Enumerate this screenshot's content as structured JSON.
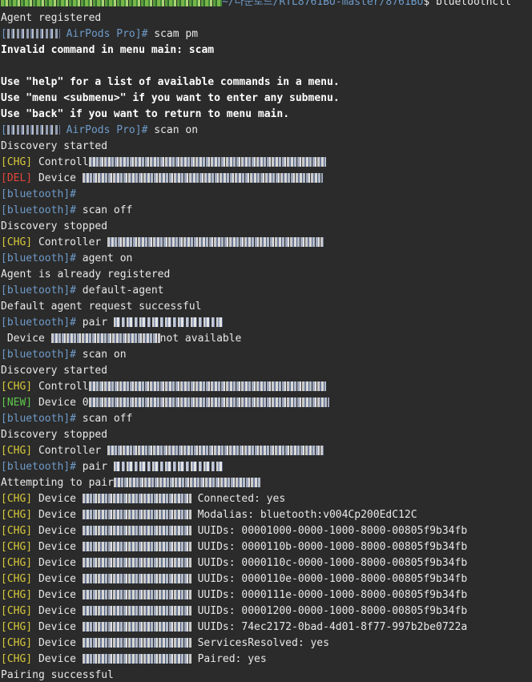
{
  "window": {
    "cwd_path": "~/다운로드/RTL8761BU-master/8761BU",
    "command": "$ bluetoothctl"
  },
  "labels": {
    "prompt_airpods": "AirPods Pro]#",
    "prompt_bluetooth": "[bluetooth]#",
    "prompt_open": "[",
    "chg": "[CHG]",
    "del": "[DEL]",
    "new": "[NEW]",
    "controller": " Controller",
    "controll": " Controll",
    "device": " Device",
    "device_0": " Device 0",
    "pair": " pair",
    "attempting": "Attempting to pair"
  },
  "lines": {
    "agent_registered": "Agent registered",
    "cmd_scam": " scam pm",
    "invalid": "Invalid command in menu main: scam",
    "help1": "Use \"help\" for a list of available commands in a menu.",
    "help2": "Use \"menu <submenu>\" if you want to enter any submenu.",
    "help3": "Use \"back\" if you want to return to menu main.",
    "cmd_scan_on": " scan on",
    "discovery_started": "Discovery started",
    "cmd_scan_off": " scan off",
    "discovery_stopped": "Discovery stopped",
    "cmd_agent_on": " agent on",
    "agent_already": "Agent is already registered",
    "cmd_default_agent": " default-agent",
    "default_agent_ok": "Default agent request successful",
    "not_available": "not available",
    "pairing_successful": "Pairing successful"
  },
  "device_events": [
    {
      "tag": "[CHG]",
      "text": "Connected: yes"
    },
    {
      "tag": "[CHG]",
      "text": "Modalias: bluetooth:v004Cp200EdC12C"
    },
    {
      "tag": "[CHG]",
      "text": "UUIDs: 00001000-0000-1000-8000-00805f9b34fb"
    },
    {
      "tag": "[CHG]",
      "text": "UUIDs: 0000110b-0000-1000-8000-00805f9b34fb"
    },
    {
      "tag": "[CHG]",
      "text": "UUIDs: 0000110c-0000-1000-8000-00805f9b34fb"
    },
    {
      "tag": "[CHG]",
      "text": "UUIDs: 0000110e-0000-1000-8000-00805f9b34fb"
    },
    {
      "tag": "[CHG]",
      "text": "UUIDs: 0000111e-0000-1000-8000-00805f9b34fb"
    },
    {
      "tag": "[CHG]",
      "text": "UUIDs: 00001200-0000-1000-8000-00805f9b34fb"
    },
    {
      "tag": "[CHG]",
      "text": "UUIDs: 74ec2172-0bad-4d01-8f77-997b2be0722a"
    },
    {
      "tag": "[CHG]",
      "text": "ServicesResolved: yes"
    },
    {
      "tag": "[CHG]",
      "text": "Paired: yes"
    }
  ],
  "colors": {
    "background": "#2b2b2b",
    "foreground": "#e8e8e8",
    "prompt_blue": "#6f9bc9",
    "tag_chg": "#d7c83a",
    "tag_del": "#e0483a",
    "tag_new": "#5ec84b"
  }
}
